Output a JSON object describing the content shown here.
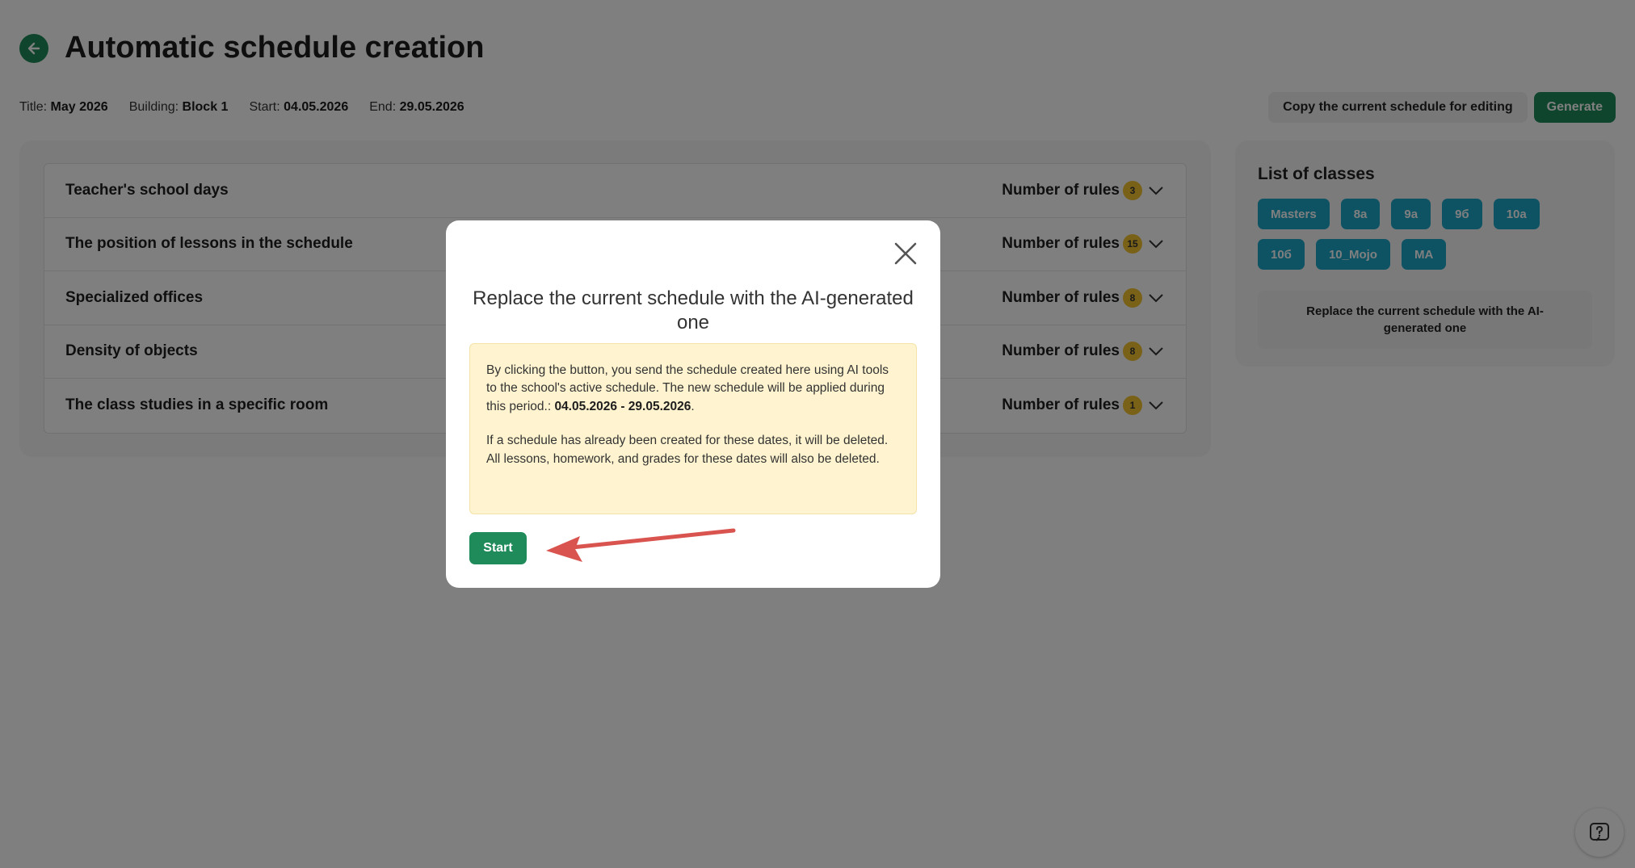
{
  "header": {
    "title": "Automatic schedule creation",
    "back_icon": "arrow-left-icon"
  },
  "meta": {
    "title_label": "Title:",
    "title_value": "May 2026",
    "building_label": "Building:",
    "building_value": "Block 1",
    "start_label": "Start:",
    "start_value": "04.05.2026",
    "end_label": "End:",
    "end_value": "29.05.2026"
  },
  "actions": {
    "copy_label": "Copy the current schedule for editing",
    "generate_label": "Generate"
  },
  "rules": {
    "count_label": "Number of rules",
    "items": [
      {
        "name": "Teacher's school days",
        "count": "3"
      },
      {
        "name": "The position of lessons in the schedule",
        "count": "15"
      },
      {
        "name": "Specialized offices",
        "count": "8"
      },
      {
        "name": "Density of objects",
        "count": "8"
      },
      {
        "name": "The class studies in a specific room",
        "count": "1"
      }
    ]
  },
  "classes": {
    "title": "List of classes",
    "items": [
      "Masters",
      "8a",
      "9a",
      "9б",
      "10a",
      "10б",
      "10_Mojo",
      "MA"
    ],
    "replace_label": "Replace the current schedule with the AI-generated one"
  },
  "modal": {
    "title": "Replace the current schedule with the AI-generated one",
    "notice_p1_text": "By clicking the button, you send the schedule created here using AI tools to the school's active schedule. The new schedule will be applied during this period.: ",
    "notice_p1_dates": "04.05.2026 - 29.05.2026",
    "notice_p1_end": ".",
    "notice_p2": "If a schedule has already been created for these dates, it will be deleted. All lessons, homework, and grades for these dates will also be deleted.",
    "start_label": "Start"
  },
  "colors": {
    "accent_green": "#1f8a5a",
    "chip_blue": "#1aa6c8",
    "badge_yellow": "#f2c231",
    "notice_bg": "#fff4cf",
    "arrow_red": "#d9534f"
  }
}
